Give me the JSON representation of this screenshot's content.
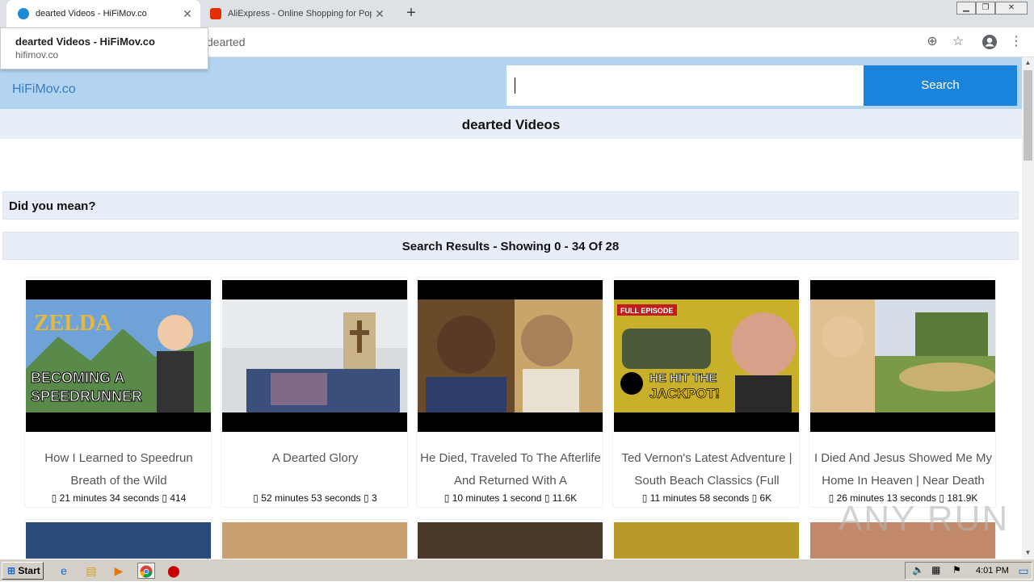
{
  "browser": {
    "tabs": [
      {
        "title": "dearted Videos - HiFiMov.co",
        "active": true,
        "favicon_color": "#1e8ad6"
      },
      {
        "title": "AliExpress - Online Shopping for Pop",
        "active": false,
        "favicon_color": "#e62e04"
      }
    ],
    "omnibox_text": "dearted",
    "tooltip": {
      "title": "dearted Videos - HiFiMov.co",
      "url": "hifimov.co"
    }
  },
  "site": {
    "logo": "HiFiMov.co",
    "search_button": "Search",
    "search_value": ""
  },
  "page": {
    "title": "dearted Videos",
    "did_you_mean": "Did you mean?",
    "results_summary": "Search Results - Showing 0 - 34 Of 28"
  },
  "videos": [
    {
      "title": "How I Learned to Speedrun Breath of the Wild",
      "duration": "21 minutes 34 seconds",
      "views": "414",
      "thumb_caption": "BECOMING A SPEEDRUNNER"
    },
    {
      "title": "A Dearted Glory",
      "duration": "52 minutes 53 seconds",
      "views": "3",
      "thumb_caption": ""
    },
    {
      "title": "He Died, Traveled To The Afterlife And Returned With A",
      "duration": "10 minutes 1 second",
      "views": "11.6K",
      "thumb_caption": ""
    },
    {
      "title": "Ted Vernon's Latest Adventure | South Beach Classics (Full",
      "duration": "11 minutes 58 seconds",
      "views": "6K",
      "thumb_caption": "HE HIT THE JACKPOT!"
    },
    {
      "title": "I Died And Jesus Showed Me My Home In Heaven | Near Death",
      "duration": "26 minutes 13 seconds",
      "views": "181.9K",
      "thumb_caption": ""
    }
  ],
  "meta_icon_glyph": "▯",
  "watermark": "ANY RUN",
  "taskbar": {
    "start_label": "Start",
    "clock": "4:01 PM"
  }
}
